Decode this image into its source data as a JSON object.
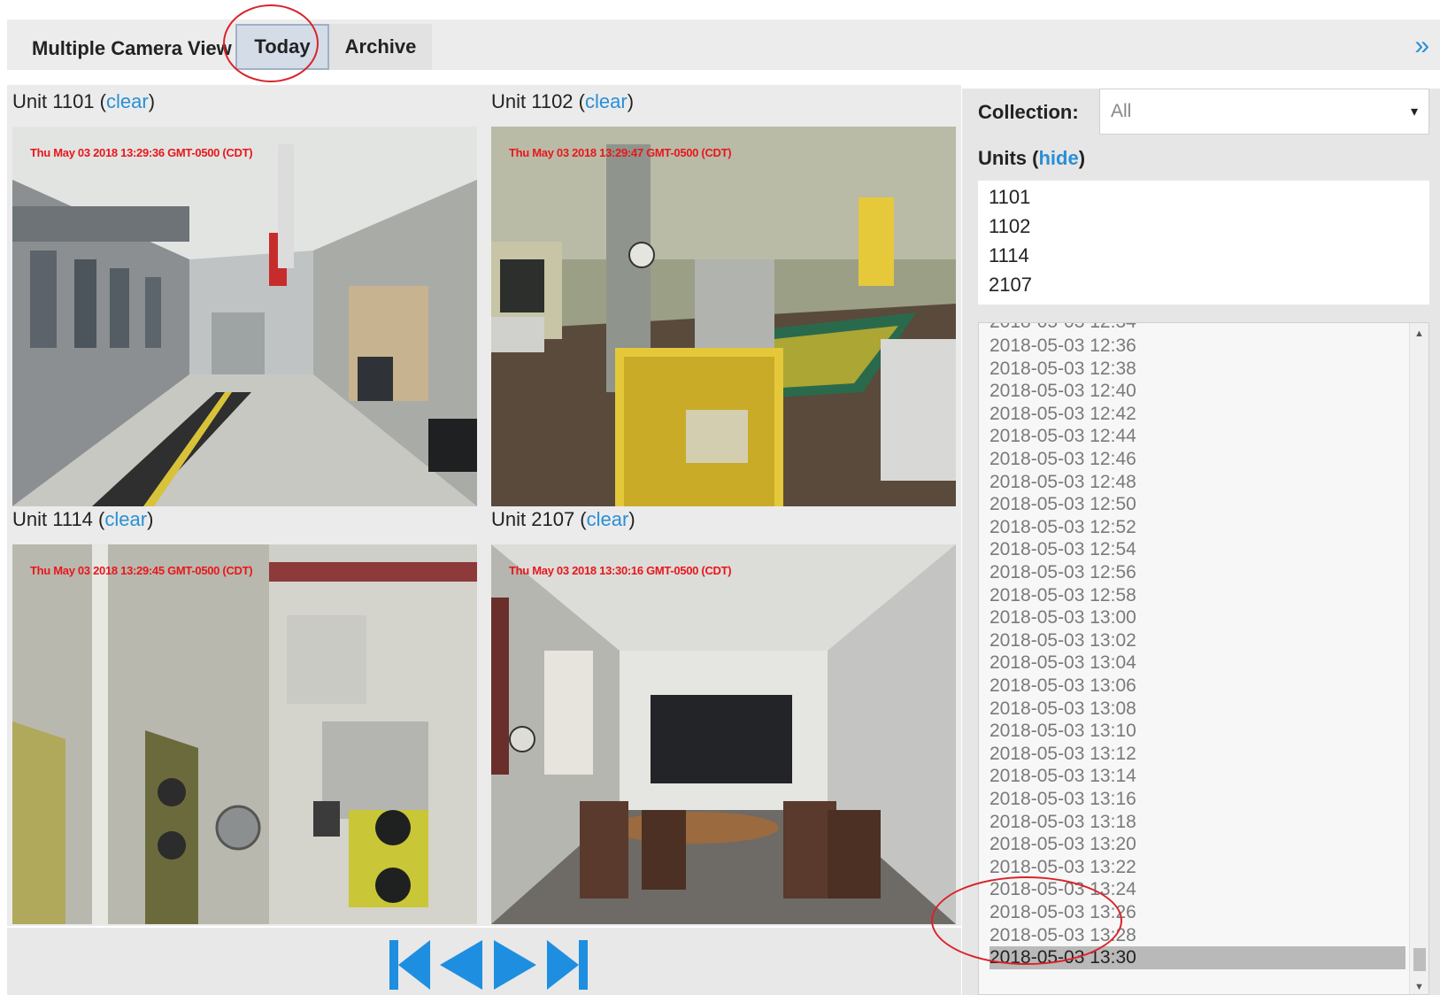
{
  "header": {
    "title": "Multiple Camera View",
    "tabs": [
      {
        "label": "Today",
        "active": true
      },
      {
        "label": "Archive",
        "active": false
      }
    ],
    "expand_icon": "double-chevron-right-icon",
    "expand_glyph": "»"
  },
  "cameras": [
    {
      "unit_label": "Unit 1101",
      "clear_label": "clear",
      "timestamp": "Thu May 03 2018 13:29:36 GMT-0500 (CDT)"
    },
    {
      "unit_label": "Unit 1102",
      "clear_label": "clear",
      "timestamp": "Thu May 03 2018 13:29:47 GMT-0500 (CDT)"
    },
    {
      "unit_label": "Unit 1114",
      "clear_label": "clear",
      "timestamp": "Thu May 03 2018 13:29:45 GMT-0500 (CDT)"
    },
    {
      "unit_label": "Unit 2107",
      "clear_label": "clear",
      "timestamp": "Thu May 03 2018 13:30:16 GMT-0500 (CDT)"
    }
  ],
  "playback": {
    "buttons": [
      "skip-to-start-icon",
      "step-back-icon",
      "step-forward-icon",
      "skip-to-end-icon"
    ],
    "color": "#1e8fe0"
  },
  "side": {
    "collection_label": "Collection:",
    "collection_value": "All",
    "collection_caret": "▾",
    "units_label": "Units",
    "hide_label": "hide",
    "units": [
      "1101",
      "1102",
      "1114",
      "2107"
    ],
    "times_partial": "2018-05-03 12:34",
    "times": [
      "2018-05-03 12:36",
      "2018-05-03 12:38",
      "2018-05-03 12:40",
      "2018-05-03 12:42",
      "2018-05-03 12:44",
      "2018-05-03 12:46",
      "2018-05-03 12:48",
      "2018-05-03 12:50",
      "2018-05-03 12:52",
      "2018-05-03 12:54",
      "2018-05-03 12:56",
      "2018-05-03 12:58",
      "2018-05-03 13:00",
      "2018-05-03 13:02",
      "2018-05-03 13:04",
      "2018-05-03 13:06",
      "2018-05-03 13:08",
      "2018-05-03 13:10",
      "2018-05-03 13:12",
      "2018-05-03 13:14",
      "2018-05-03 13:16",
      "2018-05-03 13:18",
      "2018-05-03 13:20",
      "2018-05-03 13:22",
      "2018-05-03 13:24",
      "2018-05-03 13:26",
      "2018-05-03 13:28",
      "2018-05-03 13:30"
    ],
    "selected_time": "2018-05-03 13:30",
    "scroll_up_glyph": "▲",
    "scroll_down_glyph": "▼"
  },
  "colors": {
    "accent": "#2a8fd6",
    "annotation": "#d9232a",
    "timestamp": "#e8171b"
  }
}
